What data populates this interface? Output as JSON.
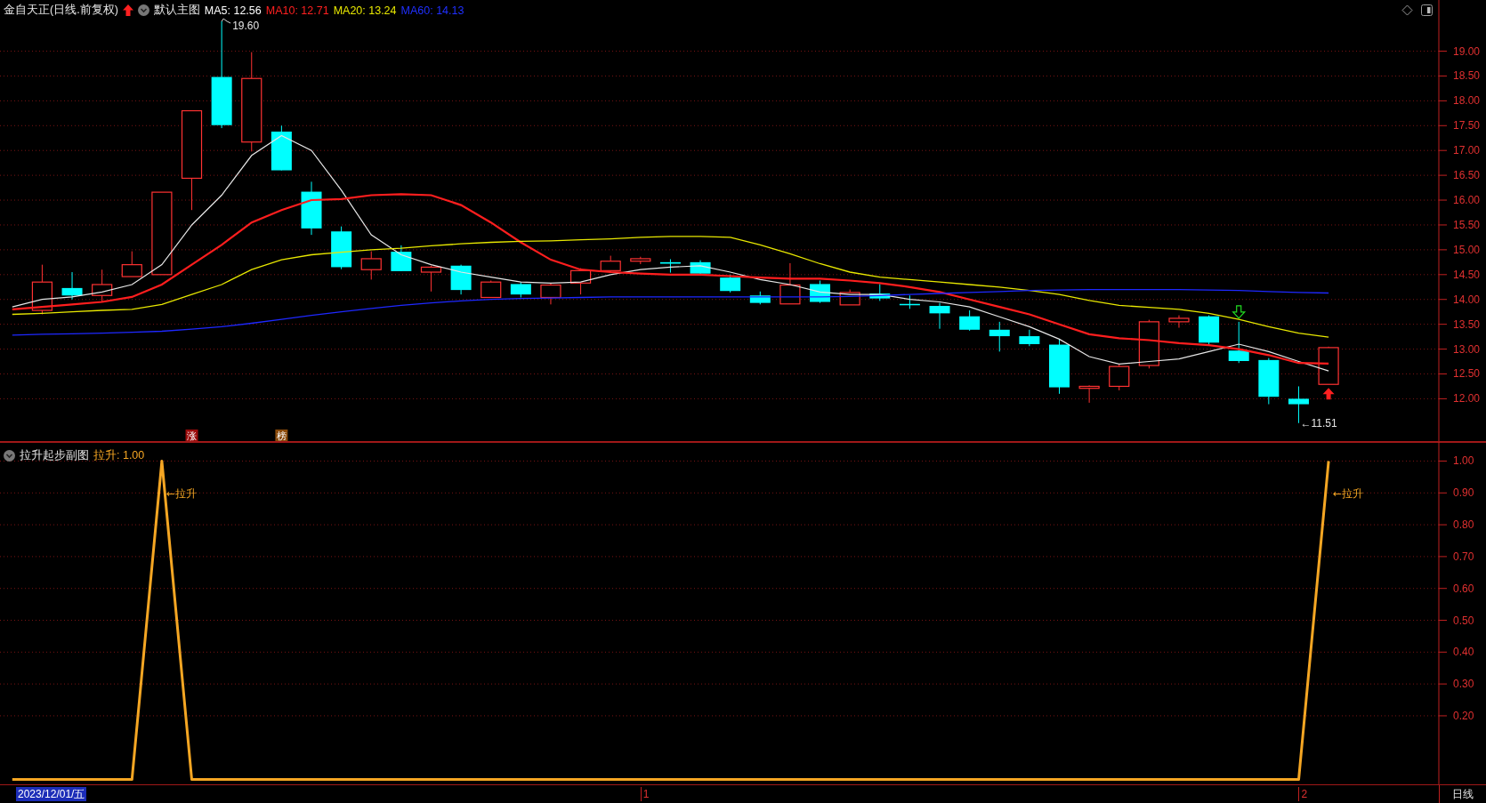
{
  "main_chart": {
    "title": "金自天正(日线.前复权)",
    "template": "默认主图",
    "indicators": [
      {
        "label": "MA5: 12.56",
        "color": "#ffffff"
      },
      {
        "label": "MA10: 12.71",
        "color": "#ff2020"
      },
      {
        "label": "MA20: 13.24",
        "color": "#e8e800"
      },
      {
        "label": "MA60: 14.13",
        "color": "#2030ff"
      }
    ],
    "chart_data": {
      "type": "line",
      "ylim": [
        11.13,
        20.03
      ],
      "grid": true,
      "yticks": [
        {
          "value": 12,
          "label": "12.00"
        },
        {
          "value": 12.5,
          "label": "12.50"
        },
        {
          "value": 13,
          "label": "13.00"
        },
        {
          "value": 13.5,
          "label": "13.50"
        },
        {
          "value": 14,
          "label": "14.00"
        },
        {
          "value": 14.5,
          "label": "14.50"
        },
        {
          "value": 15,
          "label": "15.00"
        },
        {
          "value": 15.5,
          "label": "15.50"
        },
        {
          "value": 16,
          "label": "16.00"
        },
        {
          "value": 16.5,
          "label": "16.50"
        },
        {
          "value": 17,
          "label": "17.00"
        },
        {
          "value": 17.5,
          "label": "17.50"
        },
        {
          "value": 18,
          "label": "18.00"
        },
        {
          "value": 18.5,
          "label": "18.50"
        },
        {
          "value": 19,
          "label": "19.00"
        }
      ],
      "series": [
        {
          "color": "#e6e6e6",
          "values": [
            13.85,
            14.0,
            14.05,
            14.15,
            14.3,
            14.7,
            15.5,
            16.1,
            16.9,
            17.3,
            17.0,
            16.2,
            15.3,
            14.9,
            14.7,
            14.55,
            14.45,
            14.35,
            14.33,
            14.35,
            14.5,
            14.6,
            14.65,
            14.68,
            14.55,
            14.4,
            14.3,
            14.15,
            14.1,
            14.1,
            14.0,
            13.95,
            13.85,
            13.65,
            13.45,
            13.2,
            12.85,
            12.7,
            12.75,
            12.8,
            12.95,
            13.1,
            12.95,
            12.75,
            12.56
          ]
        },
        {
          "color": "#ff1e1e",
          "values": [
            13.8,
            13.85,
            13.9,
            13.95,
            14.05,
            14.3,
            14.7,
            15.1,
            15.55,
            15.8,
            16.0,
            16.02,
            16.1,
            16.12,
            16.1,
            15.9,
            15.55,
            15.15,
            14.8,
            14.6,
            14.55,
            14.52,
            14.5,
            14.5,
            14.47,
            14.44,
            14.42,
            14.42,
            14.38,
            14.33,
            14.25,
            14.15,
            14.0,
            13.85,
            13.7,
            13.5,
            13.3,
            13.22,
            13.18,
            13.12,
            13.08,
            13.0,
            12.88,
            12.72,
            12.71
          ]
        },
        {
          "color": "#e8e800",
          "values": [
            13.7,
            13.72,
            13.75,
            13.78,
            13.8,
            13.9,
            14.1,
            14.3,
            14.6,
            14.8,
            14.9,
            14.95,
            15.0,
            15.03,
            15.08,
            15.12,
            15.15,
            15.17,
            15.18,
            15.2,
            15.22,
            15.25,
            15.27,
            15.27,
            15.25,
            15.1,
            14.92,
            14.72,
            14.55,
            14.45,
            14.4,
            14.35,
            14.3,
            14.25,
            14.18,
            14.1,
            13.98,
            13.88,
            13.84,
            13.8,
            13.72,
            13.6,
            13.45,
            13.32,
            13.24
          ]
        },
        {
          "color": "#1e28ff",
          "values": [
            13.28,
            13.3,
            13.31,
            13.32,
            13.34,
            13.36,
            13.4,
            13.45,
            13.52,
            13.6,
            13.68,
            13.75,
            13.82,
            13.88,
            13.93,
            13.97,
            14.0,
            14.02,
            14.03,
            14.04,
            14.05,
            14.05,
            14.05,
            14.05,
            14.05,
            14.05,
            14.05,
            14.05,
            14.06,
            14.08,
            14.1,
            14.12,
            14.14,
            14.16,
            14.18,
            14.19,
            14.2,
            14.2,
            14.2,
            14.2,
            14.19,
            14.18,
            14.16,
            14.14,
            14.13
          ]
        }
      ]
    },
    "candles": [
      {
        "kind": "up"
      },
      {
        "kind": "down"
      },
      {
        "kind": "up"
      },
      {
        "kind": "up"
      },
      {
        "kind": "up"
      },
      {
        "kind": "up",
        "badge": {
          "text": "涨",
          "color": "#9a0a0a"
        }
      },
      {
        "kind": "down",
        "high_label": "19.60"
      },
      {
        "kind": "up"
      },
      {
        "kind": "down",
        "badge": {
          "text": "榜",
          "color": "#8a4a0a"
        }
      },
      {
        "kind": "down"
      },
      {
        "kind": "down"
      },
      {
        "kind": "up"
      },
      {
        "kind": "down"
      },
      {
        "kind": "up"
      },
      {
        "kind": "down"
      },
      {
        "kind": "up"
      },
      {
        "kind": "down"
      },
      {
        "kind": "up"
      },
      {
        "kind": "up"
      },
      {
        "kind": "up"
      },
      {
        "kind": "up",
        "month_mark": "1"
      },
      {
        "kind": "down"
      },
      {
        "kind": "down"
      },
      {
        "kind": "down"
      },
      {
        "kind": "down"
      },
      {
        "kind": "up"
      },
      {
        "kind": "down"
      },
      {
        "kind": "up"
      },
      {
        "kind": "down"
      },
      {
        "kind": "down"
      },
      {
        "kind": "down"
      },
      {
        "kind": "down"
      },
      {
        "kind": "down"
      },
      {
        "kind": "down"
      },
      {
        "kind": "down"
      },
      {
        "kind": "up"
      },
      {
        "kind": "up"
      },
      {
        "kind": "up"
      },
      {
        "kind": "up"
      },
      {
        "kind": "down"
      },
      {
        "kind": "down",
        "down_arrow": true
      },
      {
        "kind": "down"
      },
      {
        "kind": "down",
        "low_label": "←11.51",
        "month_mark": "2"
      },
      {
        "kind": "up",
        "up_arrow": true
      }
    ]
  },
  "sub_chart": {
    "title": "拉升起步副图",
    "reading": "拉升: 1.00",
    "chart_data": {
      "type": "line",
      "ylim": [
        -0.018,
        1.06
      ],
      "grid": true,
      "yticks": [
        {
          "value": 0.2,
          "label": "0.20"
        },
        {
          "value": 0.3,
          "label": "0.30"
        },
        {
          "value": 0.4,
          "label": "0.40"
        },
        {
          "value": 0.5,
          "label": "0.50"
        },
        {
          "value": 0.6,
          "label": "0.60"
        },
        {
          "value": 0.7,
          "label": "0.70"
        },
        {
          "value": 0.8,
          "label": "0.80"
        },
        {
          "value": 0.9,
          "label": "0.90"
        },
        {
          "value": 1,
          "label": "1.00"
        }
      ],
      "series": [
        {
          "color": "#f5a623",
          "values": [
            0,
            0,
            0,
            0,
            0,
            1,
            0,
            0,
            0,
            0,
            0,
            0,
            0,
            0,
            0,
            0,
            0,
            0,
            0,
            0,
            0,
            0,
            0,
            0,
            0,
            0,
            0,
            0,
            0,
            0,
            0,
            0,
            0,
            0,
            0,
            0,
            0,
            0,
            0,
            0,
            0,
            0,
            0,
            0,
            1
          ]
        }
      ]
    },
    "peak_labels": [
      "←拉升",
      "←拉升"
    ]
  },
  "bottom_bar": {
    "date": "2023/12/01/五",
    "period": "日线"
  }
}
